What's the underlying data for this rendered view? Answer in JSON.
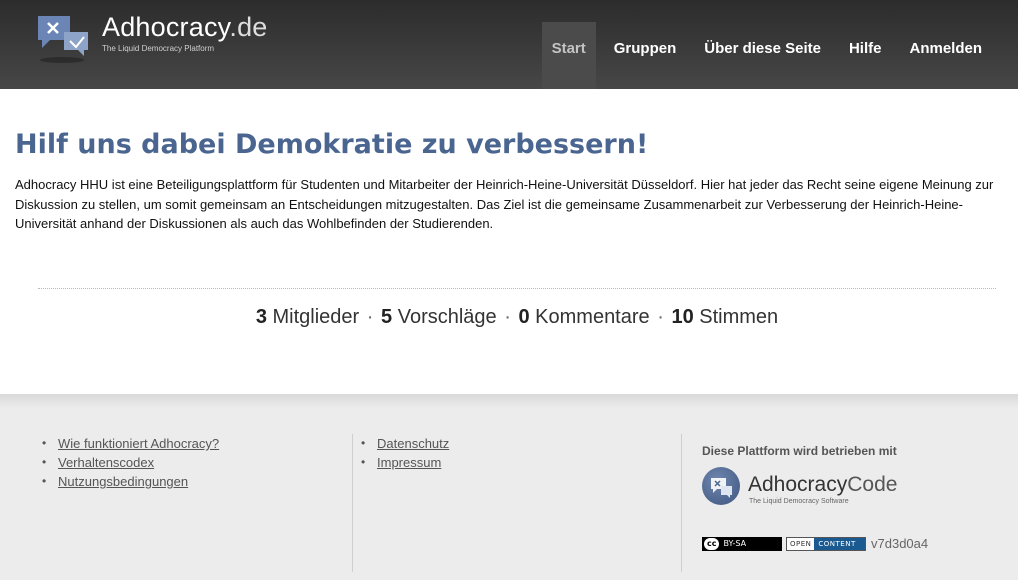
{
  "header": {
    "title": "Adhocracy",
    "tld": ".de",
    "subtitle": "The Liquid Democracy Platform",
    "nav": [
      {
        "label": "Start",
        "active": true
      },
      {
        "label": "Gruppen"
      },
      {
        "label": "Über diese Seite"
      },
      {
        "label": "Hilfe"
      },
      {
        "label": "Anmelden"
      }
    ]
  },
  "main": {
    "headline": "Hilf uns dabei Demokratie zu verbessern!",
    "intro": "Adhocracy HHU ist eine Beteiligungsplattform für Studenten und Mitarbeiter der Heinrich-Heine-Universität Düsseldorf. Hier hat jeder das Recht seine eigene Meinung zur Diskussion zu stellen, um somit gemeinsam an Entscheidungen mitzugestalten. Das Ziel ist die gemeinsame Zusammenarbeit zur Verbesserung der Heinrich-Heine-Universität anhand der Diskussionen als auch das Wohlbefinden der Studierenden.",
    "stats": {
      "members": {
        "count": "3",
        "label": "Mitglieder"
      },
      "proposals": {
        "count": "5",
        "label": "Vorschläge"
      },
      "comments": {
        "count": "0",
        "label": "Kommentare"
      },
      "votes": {
        "count": "10",
        "label": "Stimmen"
      },
      "separator": "·"
    }
  },
  "footer": {
    "col1": [
      "Wie funktioniert Adhocracy?",
      "Verhaltenscodex",
      "Nutzungsbedingungen"
    ],
    "col2": [
      "Datenschutz",
      "Impressum"
    ],
    "powered_by": "Diese Plattform wird betrieben mit",
    "adhocracy_code": {
      "title1": "Adhocracy",
      "title2": "Code",
      "subtitle": "The Liquid Democracy Software"
    },
    "cc_badge": {
      "cc": "cc",
      "text": "BY-SA"
    },
    "oc_badge": {
      "open": "OPEN",
      "content": "CONTENT"
    },
    "version": "v7d3d0a4"
  },
  "colors": {
    "header_bg": "#3a3a3a",
    "headline": "#4a6690",
    "footer_bg": "#ececec",
    "open_content_blue": "#1b5a91"
  },
  "icons": [
    "chat-bubbles-logo-icon",
    "adhocracy-code-logo-icon",
    "cc-license-icon",
    "open-content-icon"
  ]
}
